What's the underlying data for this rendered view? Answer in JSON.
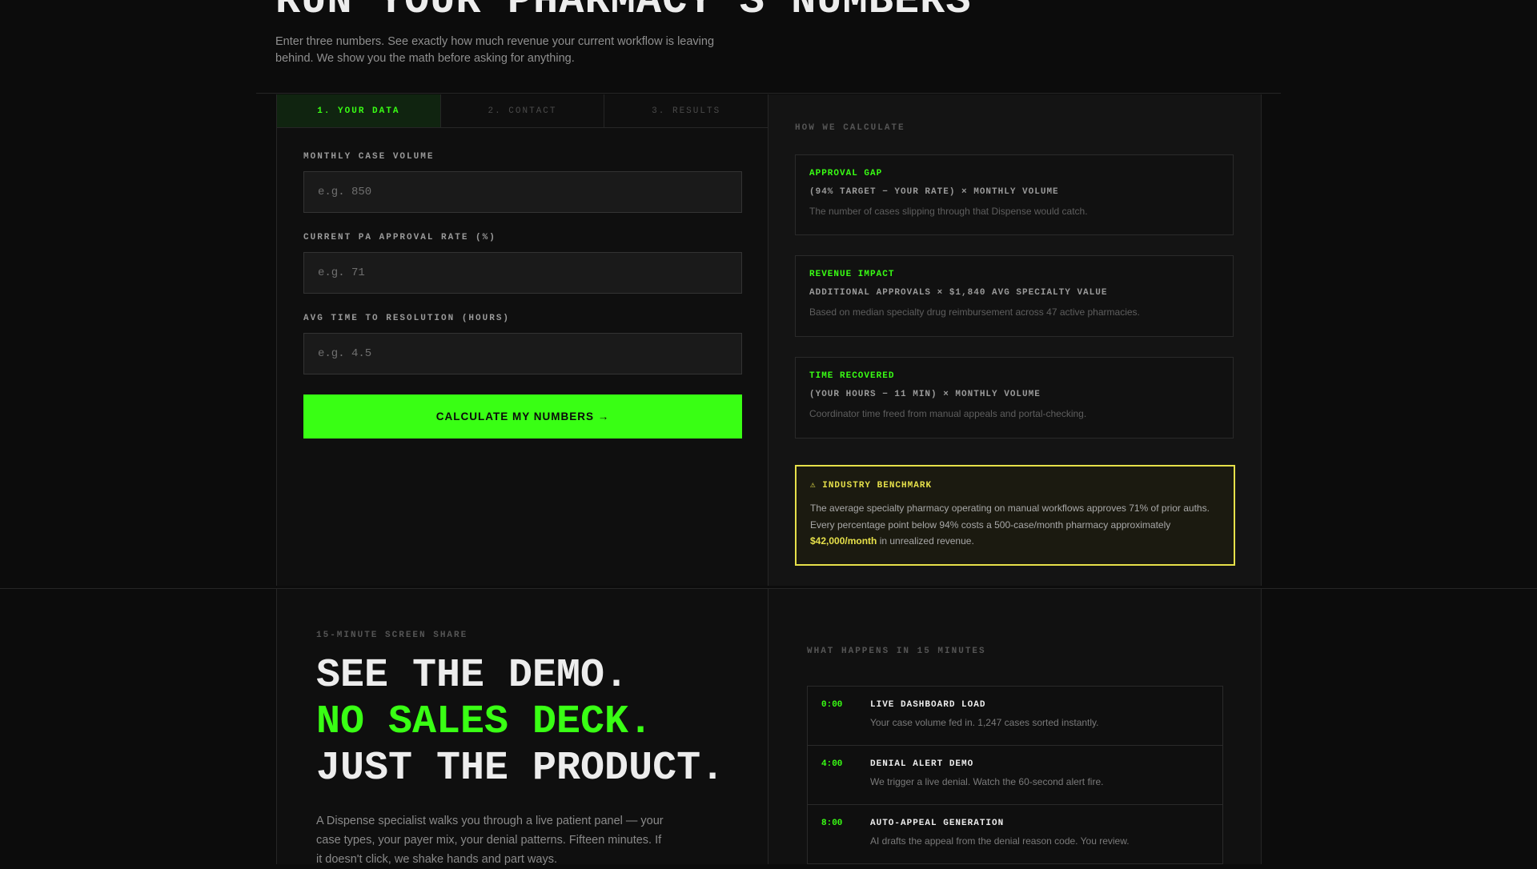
{
  "hero": {
    "title": "RUN YOUR PHARMACY'S NUMBERS",
    "description": "Enter three numbers. See exactly how much revenue your current workflow is leaving behind. We show you the math before asking for anything."
  },
  "calculator": {
    "tabs": [
      {
        "label": "1. YOUR DATA",
        "active": true
      },
      {
        "label": "2. CONTACT",
        "active": false
      },
      {
        "label": "3. RESULTS",
        "active": false
      }
    ],
    "fields": [
      {
        "label": "MONTHLY CASE VOLUME",
        "placeholder": "e.g. 850",
        "value": ""
      },
      {
        "label": "CURRENT PA APPROVAL RATE (%)",
        "placeholder": "e.g. 71",
        "value": ""
      },
      {
        "label": "AVG TIME TO RESOLUTION (HOURS)",
        "placeholder": "e.g. 4.5",
        "value": ""
      }
    ],
    "submit_label": "CALCULATE MY NUMBERS →"
  },
  "how": {
    "title": "HOW WE CALCULATE",
    "cards": [
      {
        "title": "APPROVAL GAP",
        "formula": "(94% TARGET − YOUR RATE) × MONTHLY VOLUME",
        "note": "The number of cases slipping through that Dispense would catch."
      },
      {
        "title": "REVENUE IMPACT",
        "formula": "ADDITIONAL APPROVALS × $1,840 AVG SPECIALTY VALUE",
        "note": "Based on median specialty drug reimbursement across 47 active pharmacies."
      },
      {
        "title": "TIME RECOVERED",
        "formula": "(YOUR HOURS − 11 MIN) × MONTHLY VOLUME",
        "note": "Coordinator time freed from manual appeals and portal-checking."
      }
    ],
    "benchmark": {
      "icon": "warning-icon",
      "title": "⚠ INDUSTRY BENCHMARK",
      "text_before": "The average specialty pharmacy operating on manual workflows approves 71% of prior auths. Every percentage point below 94% costs a 500-case/month pharmacy approximately ",
      "highlight": "$42,000/month",
      "text_after": " in unrealized revenue."
    }
  },
  "demo": {
    "eyebrow": "15-MINUTE SCREEN SHARE",
    "heading_line1": "SEE THE DEMO.",
    "heading_line2": "NO SALES DECK.",
    "heading_line3": "JUST THE PRODUCT.",
    "description": "A Dispense specialist walks you through a live patient panel — your case types, your payer mix, your denial patterns. Fifteen minutes. If it doesn't click, we shake hands and part ways.",
    "timeline_title": "WHAT HAPPENS IN 15 MINUTES",
    "timeline": [
      {
        "time": "0:00",
        "title": "LIVE DASHBOARD LOAD",
        "desc": "Your case volume fed in. 1,247 cases sorted instantly."
      },
      {
        "time": "4:00",
        "title": "DENIAL ALERT DEMO",
        "desc": "We trigger a live denial. Watch the 60-second alert fire."
      },
      {
        "time": "8:00",
        "title": "AUTO-APPEAL GENERATION",
        "desc": "AI drafts the appeal from the denial reason code. You review."
      }
    ]
  },
  "colors": {
    "accent": "#39ff14",
    "warning": "#e6e04a",
    "background": "#0c0c0c"
  }
}
